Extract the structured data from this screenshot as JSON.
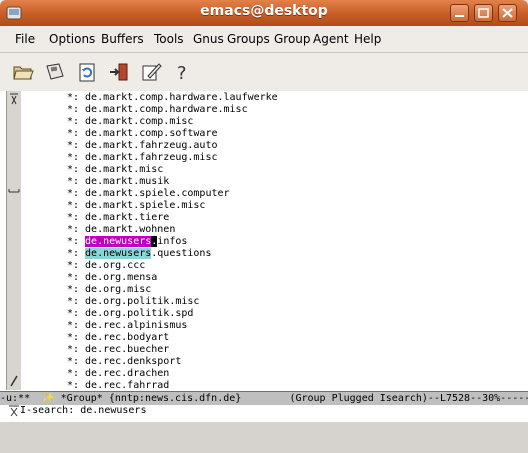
{
  "window": {
    "title": "emacs@desktop"
  },
  "menu": [
    "File",
    "Options",
    "Buffers",
    "Tools",
    "Gnus",
    "Groups",
    "Group",
    "Agent",
    "Help"
  ],
  "toolbar": {
    "icons": [
      "open-folder-icon",
      "save-disk-icon",
      "refresh-icon",
      "exit-icon",
      "edit-icon",
      "help-icon"
    ],
    "help_glyph": "?"
  },
  "buffer": {
    "mark": "*:",
    "groups": [
      "de.markt.comp.hardware.laufwerke",
      "de.markt.comp.hardware.misc",
      "de.markt.comp.misc",
      "de.markt.comp.software",
      "de.markt.fahrzeug.auto",
      "de.markt.fahrzeug.misc",
      "de.markt.misc",
      "de.markt.musik",
      "de.markt.spiele.computer",
      "de.markt.spiele.misc",
      "de.markt.tiere",
      "de.markt.wohnen",
      "de.newusers.infos",
      "de.newusers.questions",
      "de.org.ccc",
      "de.org.mensa",
      "de.org.misc",
      "de.org.politik.misc",
      "de.org.politik.spd",
      "de.rec.alpinismus",
      "de.rec.bodyart",
      "de.rec.buecher",
      "de.rec.denksport",
      "de.rec.drachen",
      "de.rec.fahrrad"
    ],
    "highlight_current": {
      "prefix": "de.newusers",
      "cursor": ".",
      "suffix": "infos"
    },
    "highlight_other": {
      "prefix": "de.newusers",
      "suffix": ".questions"
    }
  },
  "modeline": {
    "left": "-u:**  ",
    "buffer": "*Group*",
    "server": "{nntp:news.cis.dfn.de}",
    "mode": "(Group Plugged Isearch)--L7528--30%-----"
  },
  "minibuffer": {
    "text": "  I-search: de.newusers"
  },
  "colors": {
    "title_orange": "#c85d25",
    "isearch_current": "#c000c0",
    "isearch_other": "#8ad6d6"
  }
}
